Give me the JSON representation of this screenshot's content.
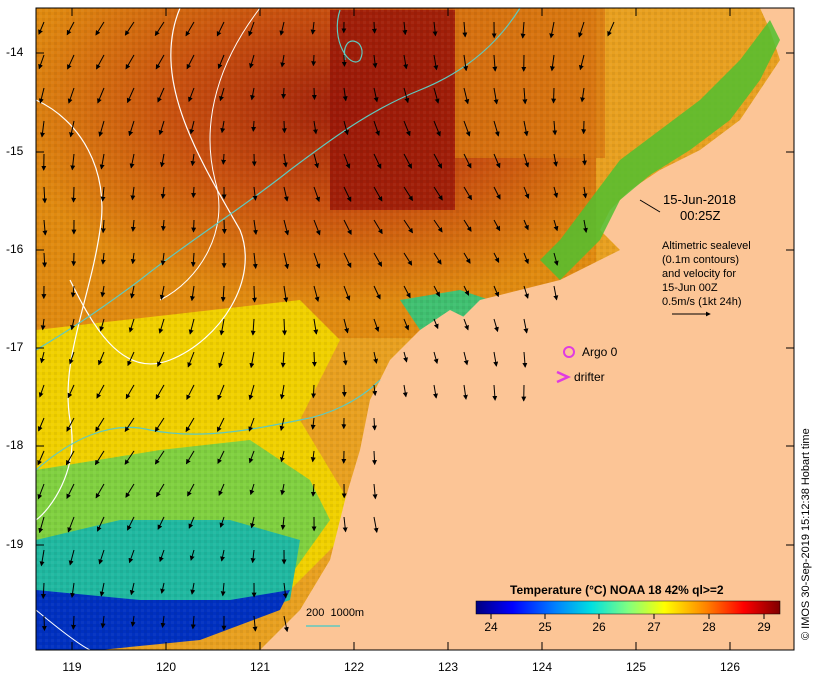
{
  "map": {
    "y_ticks": [
      "-14",
      "-15",
      "-16",
      "-17",
      "-18",
      "-19"
    ],
    "x_ticks": [
      "119",
      "120",
      "121",
      "122",
      "123",
      "124",
      "125",
      "126"
    ],
    "date": "15-Jun-2018",
    "time": "00:25Z",
    "altimetry_note": [
      "Altimetric sealevel",
      "(0.1m contours)",
      "and velocity for",
      "15-Jun 00Z",
      "0.5m/s (1kt 24h)"
    ],
    "argo_label": "Argo 0",
    "drifter_label": "drifter",
    "depth_label": "200  1000m",
    "credit": "© IMOS 30-Sep-2019 15:12:38 Hobart time",
    "colorbar": {
      "title": "Temperature (°C) NOAA 18 42% ql>=2",
      "ticks": [
        "24",
        "25",
        "26",
        "27",
        "28",
        "29"
      ],
      "colors": [
        "#00007f",
        "#0000ff",
        "#0080ff",
        "#00ffff",
        "#80ff80",
        "#ffff00",
        "#ff8000",
        "#ff0000",
        "#7f0000"
      ]
    },
    "colors": {
      "land": "#fcc596",
      "contour_white": "#ffffff",
      "contour_cyan": "#5fc9bf",
      "argo": "#e03ce0"
    }
  }
}
